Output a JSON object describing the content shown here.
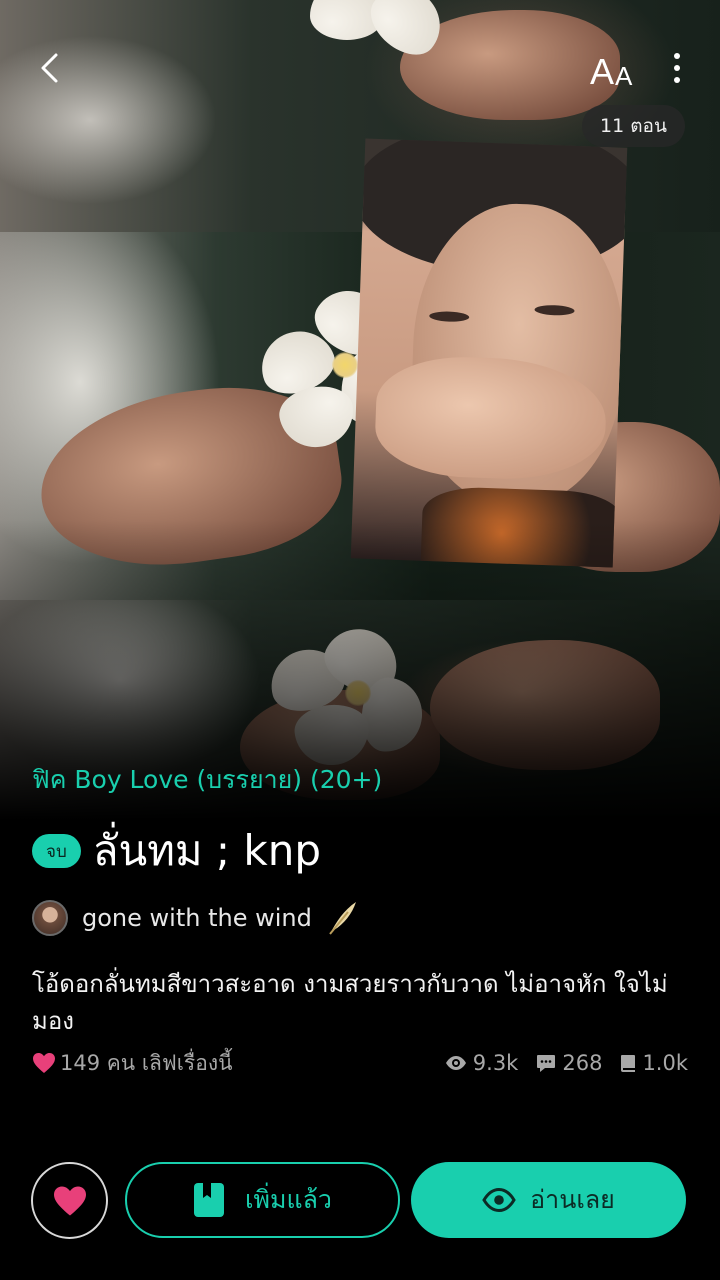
{
  "header": {
    "font_size_glyph_large": "A",
    "font_size_glyph_small": "A",
    "chapter_count": "11 ตอน"
  },
  "story": {
    "category": "ฟิค Boy Love (บรรยาย) (20+)",
    "status_badge": "จบ",
    "title": "ลั่นทม ; knp",
    "author": "gone with the wind",
    "description": "โอ้ดอกลั่นทมสีขาวสะอาด งามสวยราวกับวาด ไม่อาจหัก ใจไม่มอง",
    "likes_text": "149 คน เลิฟเรื่องนี้",
    "views": "9.3k",
    "comments": "268",
    "chapters_read": "1.0k"
  },
  "actions": {
    "added_label": "เพิ่มแล้ว",
    "read_label": "อ่านเลย"
  },
  "colors": {
    "accent": "#19cfae",
    "heart": "#e8407a",
    "background": "#000000"
  },
  "icons": [
    "back-arrow-icon",
    "more-vertical-icon",
    "quill-icon",
    "heart-icon",
    "eye-icon",
    "comment-icon",
    "book-icon",
    "bookmark-book-icon"
  ]
}
